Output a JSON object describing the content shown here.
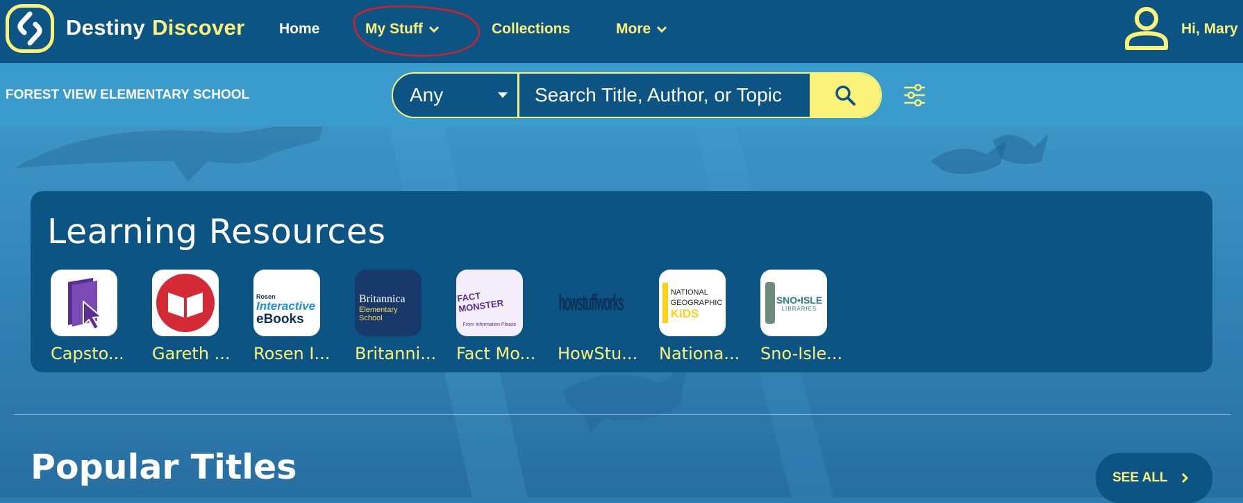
{
  "brand": {
    "name_part1": "Destiny",
    "name_part2": "Discover"
  },
  "nav": {
    "home": "Home",
    "my_stuff": "My Stuff",
    "collections": "Collections",
    "more": "More"
  },
  "user": {
    "greeting": "Hi, Mary"
  },
  "school": {
    "name": "FOREST VIEW ELEMENTARY SCHOOL"
  },
  "search": {
    "scope_selected": "Any",
    "placeholder": "Search Title, Author, or Topic"
  },
  "learning_resources": {
    "title": "Learning Resources",
    "items": [
      {
        "label": "Capsto...",
        "icon": "capstone-icon"
      },
      {
        "label": "Gareth ...",
        "icon": "gareth-stevens-icon"
      },
      {
        "label": "Rosen I...",
        "icon": "rosen-interactive-ebooks-icon",
        "logo_lines": [
          "Rosen",
          "Interactive",
          "eBooks"
        ]
      },
      {
        "label": "Britanni...",
        "icon": "britannica-elementary-icon",
        "logo_lines": [
          "Britannica",
          "Elementary",
          "School"
        ]
      },
      {
        "label": "Fact Mo...",
        "icon": "fact-monster-icon",
        "logo_lines": [
          "FACT MONSTER",
          "From Information Please"
        ]
      },
      {
        "label": "HowStu...",
        "icon": "howstuffworks-icon",
        "logo_lines": [
          "howstuffworks"
        ]
      },
      {
        "label": "Nationa...",
        "icon": "national-geographic-kids-icon",
        "logo_lines": [
          "NATIONAL",
          "GEOGRAPHIC",
          "KiDS"
        ]
      },
      {
        "label": "Sno-Isle...",
        "icon": "sno-isle-libraries-icon",
        "logo_lines": [
          "SNO•ISLE",
          "LIBRARIES"
        ]
      }
    ]
  },
  "popular_titles": {
    "title": "Popular Titles",
    "see_all": "SEE ALL"
  },
  "colors": {
    "nav_bg": "#0c5484",
    "search_row_bg": "#3a9bcd",
    "accent_yellow": "#fbf27a",
    "annotation_red": "#d42027"
  }
}
